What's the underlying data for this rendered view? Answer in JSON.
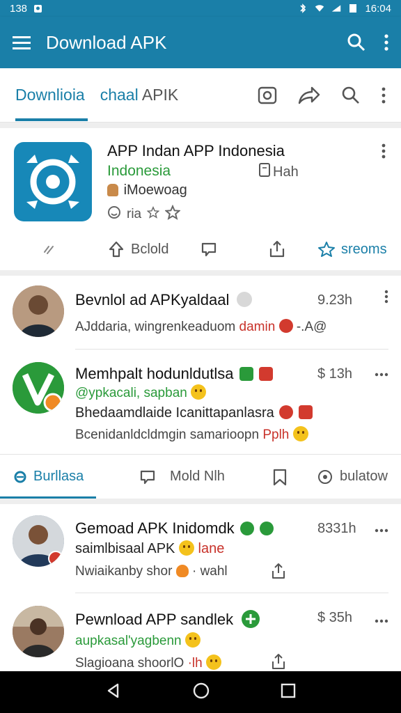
{
  "status_bar": {
    "time_left": "138",
    "time_right": "16:04"
  },
  "app_bar": {
    "title": "Download APK"
  },
  "tabs": {
    "active": "Downlioia",
    "second_blue": "chaal",
    "second_grey": "APIK"
  },
  "app_card": {
    "title": "APP Indan APP Indonesia",
    "subtitle": "Indonesia",
    "meta": "Hah",
    "developer": "iMoewoag",
    "rating_text": "ria",
    "actions": {
      "share": "Bclold",
      "sreoms": "sreoms"
    }
  },
  "feed": [
    {
      "title": "Bevnlol ad APKyaldaal",
      "time": "9.23h",
      "line1": "AJddaria, wingrenkeaduom",
      "line1_red": "damin",
      "line1_tail": "-.A@"
    },
    {
      "title": "Memhpalt hodunldutlsa",
      "time": "$ 13h",
      "line1": "@ypkacali, sapban",
      "line2": "Bhedaamdlaide Icanittapanlasra",
      "line3": "Bcenidanldcldmgin samarioopn",
      "line3_red": "Pplh"
    }
  ],
  "sub_tabs": {
    "active": "Burllasa",
    "second": "Mold Nlh",
    "third": "bulatow"
  },
  "feed2": [
    {
      "title": "Gemoad APK Inidomdk",
      "time": "8331h",
      "line1": "saimlbisaal APK",
      "line1_red": "lane",
      "line2": "Nwiaikanby shor",
      "line2_tail": "· wahl"
    },
    {
      "title": "Pewnload APP sandlek",
      "time": "$ 35h",
      "line1": "aupkasal'yagbenn",
      "line2": "Slagioana shoorlO",
      "line2_red": "·lh"
    }
  ],
  "colors": {
    "primary": "#1a7fa8",
    "green": "#2a9a3a",
    "red": "#c8322a",
    "navbar": "#000000"
  }
}
